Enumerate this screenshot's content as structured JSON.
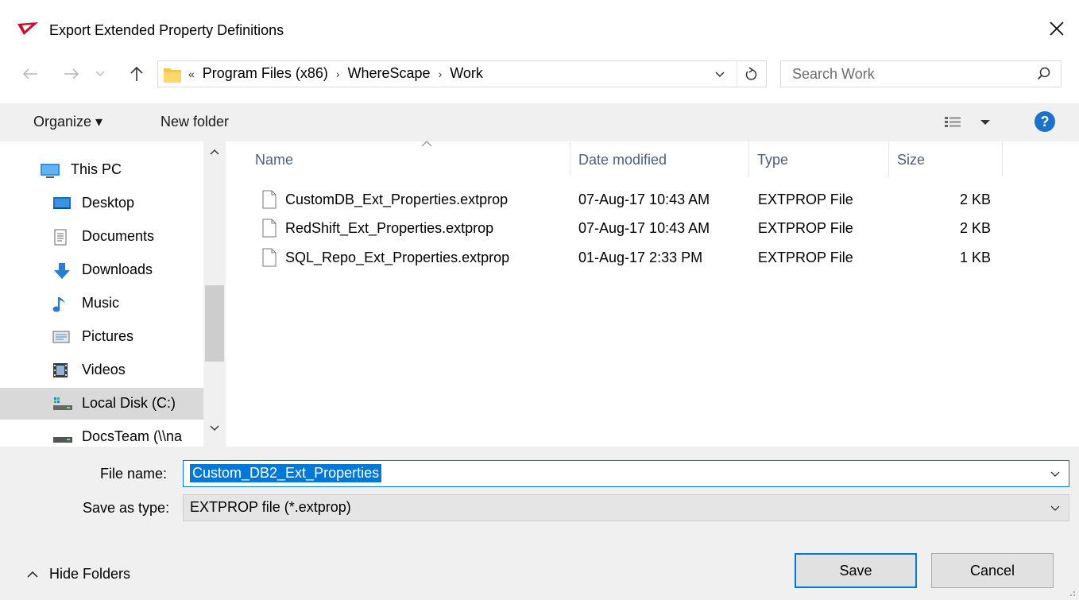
{
  "window": {
    "title": "Export Extended Property Definitions",
    "close_label": "✕"
  },
  "address_bar": {
    "overflow": "«",
    "crumbs": [
      "Program Files (x86)",
      "WhereScape",
      "Work"
    ]
  },
  "search": {
    "placeholder": "Search Work"
  },
  "toolbar": {
    "organize_label": "Organize ▾",
    "new_folder_label": "New folder"
  },
  "nav_pane": {
    "items": [
      {
        "label": "This PC",
        "icon": "computer-icon"
      },
      {
        "label": "Desktop",
        "icon": "desktop-icon"
      },
      {
        "label": "Documents",
        "icon": "documents-icon"
      },
      {
        "label": "Downloads",
        "icon": "downloads-icon"
      },
      {
        "label": "Music",
        "icon": "music-icon"
      },
      {
        "label": "Pictures",
        "icon": "pictures-icon"
      },
      {
        "label": "Videos",
        "icon": "videos-icon"
      },
      {
        "label": "Local Disk (C:)",
        "icon": "drive-icon",
        "selected": true
      },
      {
        "label": "DocsTeam (\\\\na",
        "icon": "network-drive-icon"
      }
    ]
  },
  "file_list": {
    "columns": [
      "Name",
      "Date modified",
      "Type",
      "Size"
    ],
    "rows": [
      {
        "name": "CustomDB_Ext_Properties.extprop",
        "date": "07-Aug-17 10:43 AM",
        "type": "EXTPROP File",
        "size": "2 KB"
      },
      {
        "name": "RedShift_Ext_Properties.extprop",
        "date": "07-Aug-17 10:43 AM",
        "type": "EXTPROP File",
        "size": "2 KB"
      },
      {
        "name": "SQL_Repo_Ext_Properties.extprop",
        "date": "01-Aug-17 2:33 PM",
        "type": "EXTPROP File",
        "size": "1 KB"
      }
    ]
  },
  "form": {
    "file_name_label": "File name:",
    "file_name_value": "Custom_DB2_Ext_Properties",
    "save_type_label": "Save as type:",
    "save_type_value": "EXTPROP file (*.extprop)"
  },
  "footer": {
    "hide_folders_label": "Hide Folders",
    "save_label": "Save",
    "cancel_label": "Cancel"
  },
  "colors": {
    "accent": "#0078d7",
    "help": "#1a73c8",
    "app_icon": "#c8102e"
  }
}
